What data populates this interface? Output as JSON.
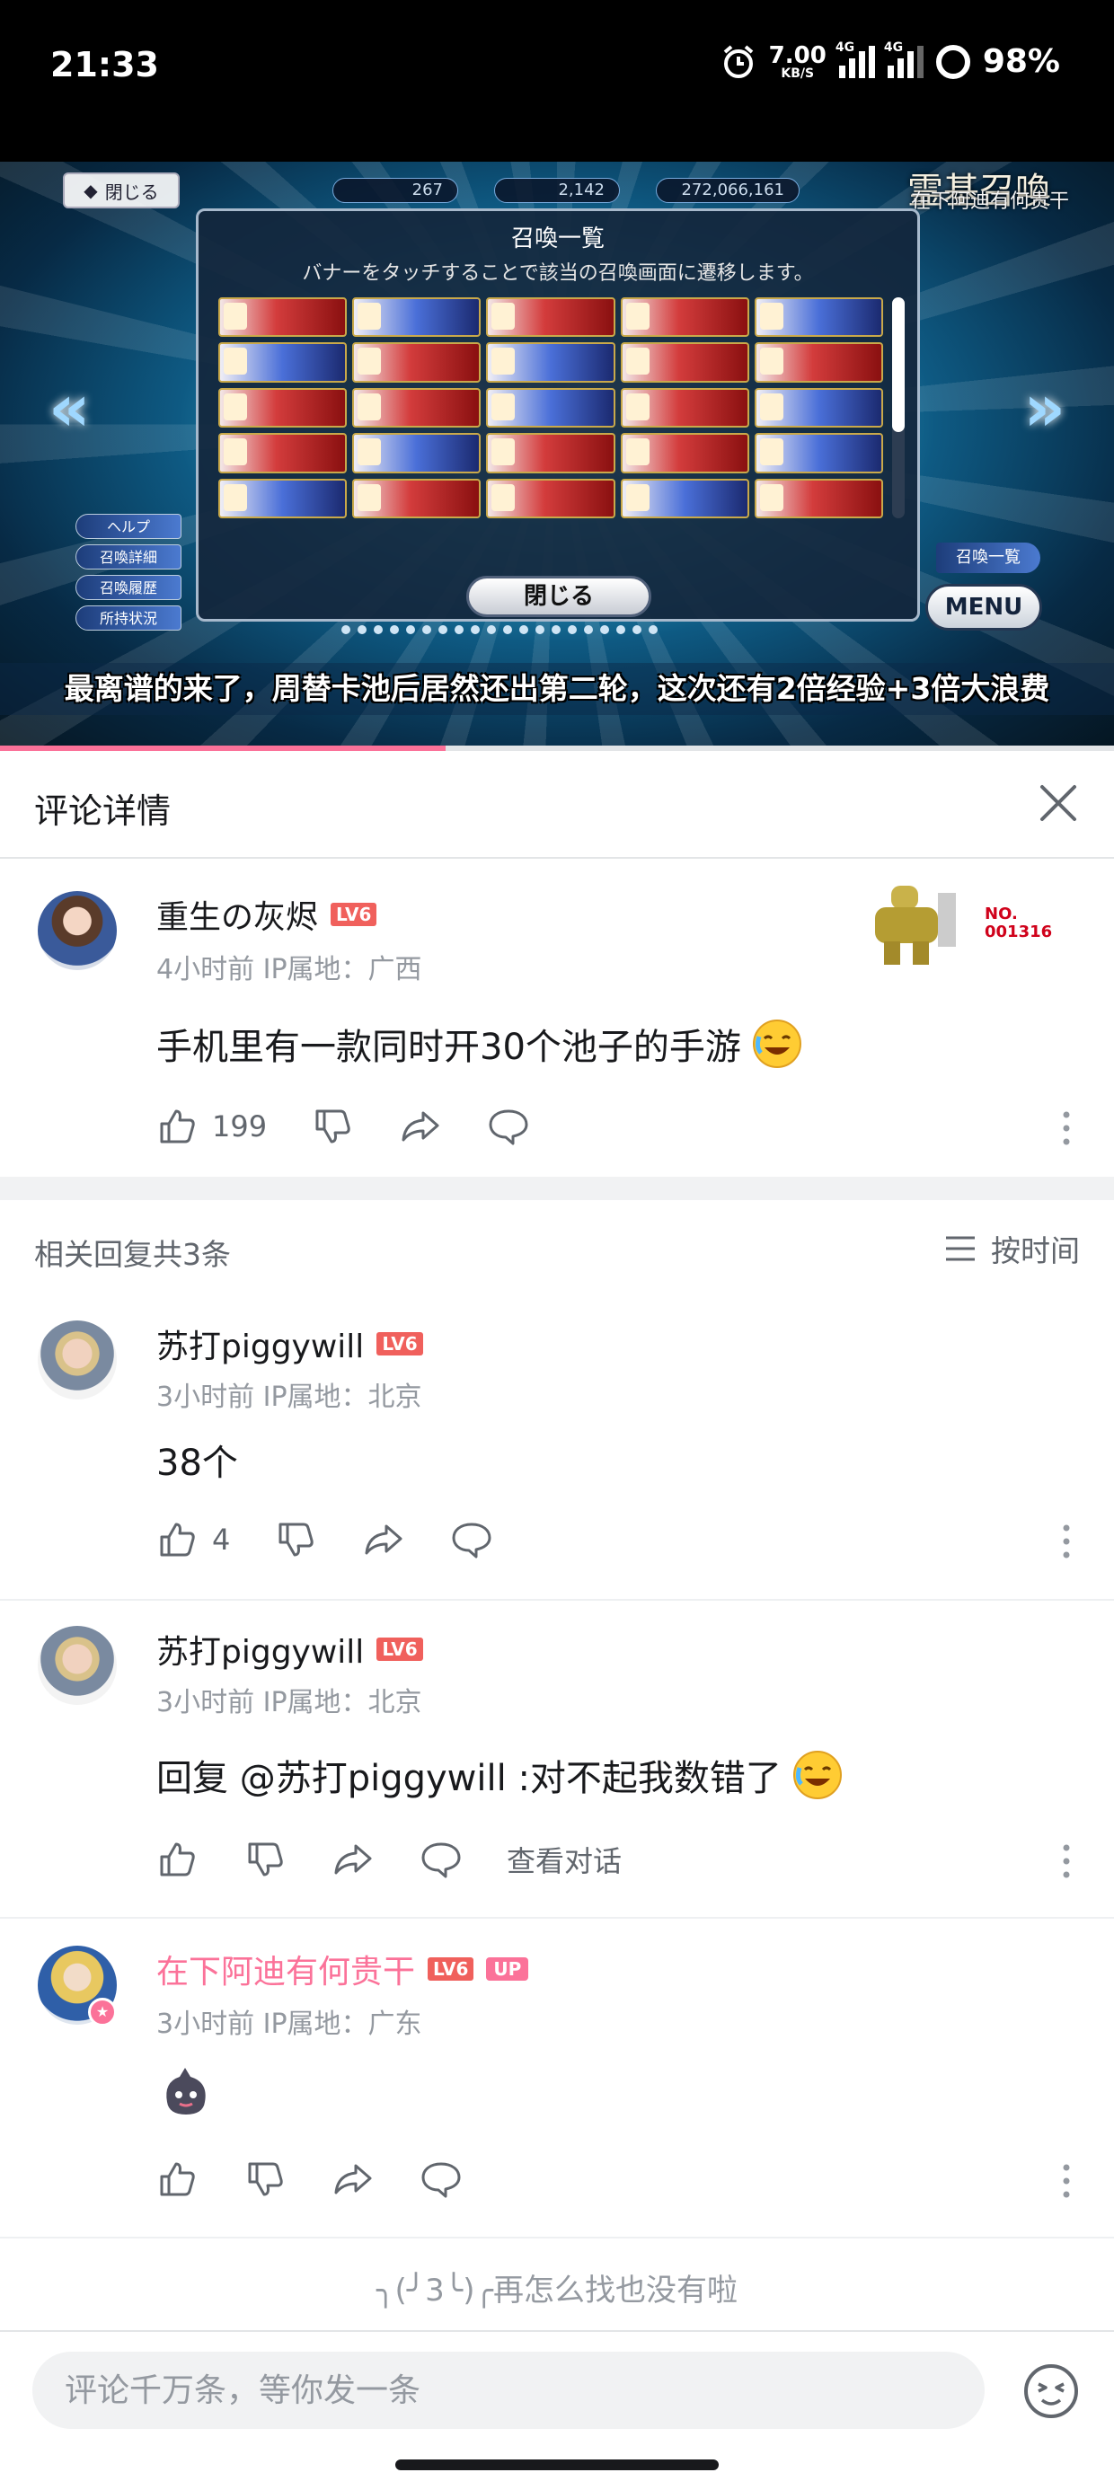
{
  "status_bar": {
    "time": "21:33",
    "net_speed_value": "7.00",
    "net_speed_unit": "KB/S",
    "sim1": "4G",
    "sim2": "4G",
    "battery": "98%"
  },
  "video": {
    "progress_fraction": 0.4,
    "close_label": "閉じる",
    "counter1": "267",
    "counter2": "2,142",
    "counter3": "272,066,161",
    "scene_title": "霊基召喚",
    "watermark": "在下阿迪有何贵干",
    "panel_title": "召喚一覧",
    "panel_hint": "バナーをタッチすることで該当の召喚画面に遷移します。",
    "panel_button": "閉じる",
    "left_menu": [
      "ヘルプ",
      "召喚詳細",
      "召喚履歴",
      "所持状況"
    ],
    "right_button": "召喚一覧",
    "menu_button": "MENU",
    "caption": "最离谱的来了，周替卡池后居然还出第二轮，这次还有2倍经验+3倍大浪费"
  },
  "header": {
    "title": "评论详情"
  },
  "main_comment": {
    "username": "重生の灰烬",
    "level": "LV6",
    "meta": "4小时前 IP属地：广西",
    "text": "手机里有一款同时开30个池子的手游",
    "like_count": "199",
    "badge_no": "NO.",
    "badge_id": "001316"
  },
  "replies": {
    "count_label": "相关回复共3条",
    "sort_label": "按时间",
    "items": [
      {
        "username": "苏打piggywill",
        "level": "LV6",
        "meta": "3小时前 IP属地：北京",
        "text": "38个",
        "like_count": "4"
      },
      {
        "username": "苏打piggywill",
        "level": "LV6",
        "meta": "3小时前 IP属地：北京",
        "text": "回复 @苏打piggywill :对不起我数错了",
        "view_dialog": "查看对话"
      },
      {
        "username": "在下阿迪有何贵干",
        "level": "LV6",
        "up_badge": "UP",
        "meta": "3小时前 IP属地：广东"
      }
    ]
  },
  "end_text": "╮(╯3╰)╭再怎么找也没有啦",
  "input": {
    "placeholder": "评论千万条，等你发一条"
  },
  "colors": {
    "accent_pink": "#fb7299",
    "level_red": "#f0605c",
    "text_gray": "#9499a0"
  }
}
